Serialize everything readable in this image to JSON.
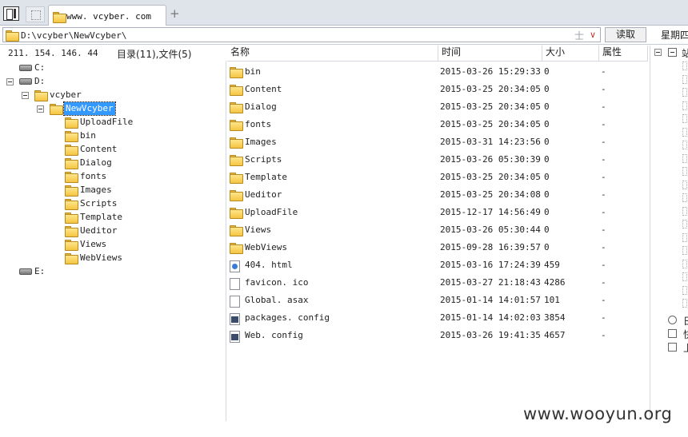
{
  "tab": {
    "title": "www. vcyber. com",
    "add_label": "+"
  },
  "address": {
    "path": "D:\\vcyber\\NewVcyber\\",
    "star": "士",
    "dropdown": "∨",
    "read_button": "读取",
    "weekday": "星期四"
  },
  "left": {
    "ip": "211. 154. 146. 44",
    "dir_count": "目录(11),文件(5)",
    "tree": {
      "c_drive": "C:",
      "d_drive": "D:",
      "vcyber": "vcyber",
      "newvcyber": "NewVcyber",
      "children": [
        "UploadFile",
        "bin",
        "Content",
        "Dialog",
        "fonts",
        "Images",
        "Scripts",
        "Template",
        "Ueditor",
        "Views",
        "WebViews"
      ],
      "e_drive": "E:"
    }
  },
  "list": {
    "headers": {
      "name": "名称",
      "time": "时间",
      "size": "大小",
      "attr": "属性"
    },
    "rows": [
      {
        "name": "bin",
        "time": "2015-03-26 15:29:33",
        "size": "0",
        "attr": "-",
        "icon": "folder-icon"
      },
      {
        "name": "Content",
        "time": "2015-03-25 20:34:05",
        "size": "0",
        "attr": "-",
        "icon": "folder-icon"
      },
      {
        "name": "Dialog",
        "time": "2015-03-25 20:34:05",
        "size": "0",
        "attr": "-",
        "icon": "folder-icon"
      },
      {
        "name": "fonts",
        "time": "2015-03-25 20:34:05",
        "size": "0",
        "attr": "-",
        "icon": "folder-icon"
      },
      {
        "name": "Images",
        "time": "2015-03-31 14:23:56",
        "size": "0",
        "attr": "-",
        "icon": "folder-icon"
      },
      {
        "name": "Scripts",
        "time": "2015-03-26 05:30:39",
        "size": "0",
        "attr": "-",
        "icon": "folder-icon"
      },
      {
        "name": "Template",
        "time": "2015-03-25 20:34:05",
        "size": "0",
        "attr": "-",
        "icon": "folder-icon"
      },
      {
        "name": "Ueditor",
        "time": "2015-03-25 20:34:08",
        "size": "0",
        "attr": "-",
        "icon": "folder-icon"
      },
      {
        "name": "UploadFile",
        "time": "2015-12-17 14:56:49",
        "size": "0",
        "attr": "-",
        "icon": "folder-icon"
      },
      {
        "name": "Views",
        "time": "2015-03-26 05:30:44",
        "size": "0",
        "attr": "-",
        "icon": "folder-icon"
      },
      {
        "name": "WebViews",
        "time": "2015-09-28 16:39:57",
        "size": "0",
        "attr": "-",
        "icon": "folder-icon"
      },
      {
        "name": "404. html",
        "time": "2015-03-16 17:24:39",
        "size": "459",
        "attr": "-",
        "icon": "html-file-icon"
      },
      {
        "name": "favicon. ico",
        "time": "2015-03-27 21:18:43",
        "size": "4286",
        "attr": "-",
        "icon": "file-icon"
      },
      {
        "name": "Global. asax",
        "time": "2015-01-14 14:01:57",
        "size": "101",
        "attr": "-",
        "icon": "file-icon"
      },
      {
        "name": "packages. config",
        "time": "2015-01-14 14:02:03",
        "size": "3854",
        "attr": "-",
        "icon": "config-file-icon"
      },
      {
        "name": "Web. config",
        "time": "2015-03-26 19:41:35",
        "size": "4657",
        "attr": "-",
        "icon": "config-file-icon"
      }
    ]
  },
  "right": {
    "first": "站",
    "items": [
      "日",
      "快",
      "上"
    ]
  },
  "watermark": "www.wooyun.org",
  "colors": {
    "selection": "#3399ff",
    "folder": "#f4c542",
    "tabbar": "#dfe3ea"
  }
}
